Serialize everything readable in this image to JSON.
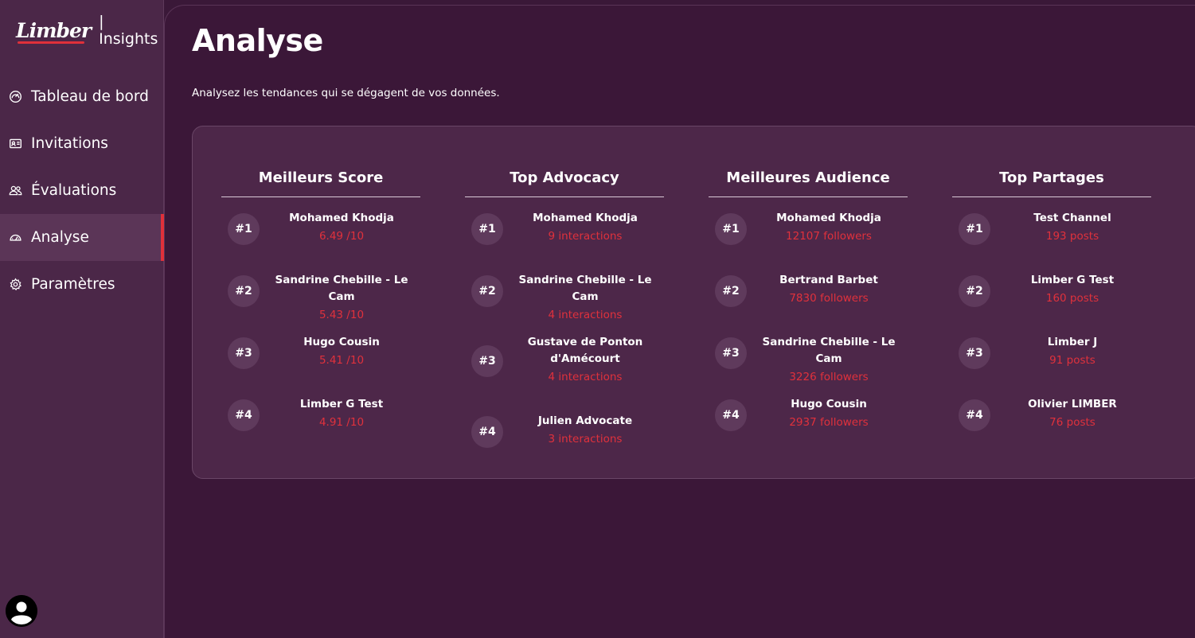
{
  "brand": {
    "logo_text": "Limber",
    "separator": "|",
    "product": "Insights"
  },
  "sidebar": {
    "items": [
      {
        "label": "Tableau de bord",
        "icon": "gauge-icon",
        "active": false
      },
      {
        "label": "Invitations",
        "icon": "id-card-icon",
        "active": false
      },
      {
        "label": "Évaluations",
        "icon": "users-icon",
        "active": false
      },
      {
        "label": "Analyse",
        "icon": "speedometer-icon",
        "active": true
      },
      {
        "label": "Paramètres",
        "icon": "gear-icon",
        "active": false
      }
    ],
    "avatar_icon": "user-avatar-icon"
  },
  "page": {
    "title": "Analyse",
    "subtitle": "Analysez les tendances qui se dégagent de vos données."
  },
  "columns": [
    {
      "title": "Meilleurs Score",
      "entries": [
        {
          "rank": "#1",
          "name": "Mohamed Khodja",
          "value": "6.49 /10"
        },
        {
          "rank": "#2",
          "name": "Sandrine Chebille - Le Cam",
          "value": "5.43 /10"
        },
        {
          "rank": "#3",
          "name": "Hugo Cousin",
          "value": "5.41 /10"
        },
        {
          "rank": "#4",
          "name": "Limber G Test",
          "value": "4.91 /10"
        }
      ]
    },
    {
      "title": "Top Advocacy",
      "entries": [
        {
          "rank": "#1",
          "name": "Mohamed Khodja",
          "value": "9 interactions"
        },
        {
          "rank": "#2",
          "name": "Sandrine Chebille - Le Cam",
          "value": "4 interactions"
        },
        {
          "rank": "#3",
          "name": "Gustave de Ponton d'Amécourt",
          "value": "4 interactions"
        },
        {
          "rank": "#4",
          "name": "Julien Advocate",
          "value": "3 interactions"
        }
      ]
    },
    {
      "title": "Meilleures Audience",
      "entries": [
        {
          "rank": "#1",
          "name": "Mohamed Khodja",
          "value": "12107 followers"
        },
        {
          "rank": "#2",
          "name": "Bertrand Barbet",
          "value": "7830 followers"
        },
        {
          "rank": "#3",
          "name": "Sandrine Chebille - Le Cam",
          "value": "3226 followers"
        },
        {
          "rank": "#4",
          "name": "Hugo Cousin",
          "value": "2937 followers"
        }
      ]
    },
    {
      "title": "Top Partages",
      "entries": [
        {
          "rank": "#1",
          "name": "Test Channel",
          "value": "193 posts"
        },
        {
          "rank": "#2",
          "name": "Limber G Test",
          "value": "160 posts"
        },
        {
          "rank": "#3",
          "name": "Limber J",
          "value": "91 posts"
        },
        {
          "rank": "#4",
          "name": "Olivier LIMBER",
          "value": "76 posts"
        }
      ]
    }
  ],
  "colors": {
    "background": "#3a1838",
    "sidebar": "#4b2748",
    "panel": "#4d2749",
    "accent": "#e0303a",
    "badge": "#5f3a5c"
  }
}
